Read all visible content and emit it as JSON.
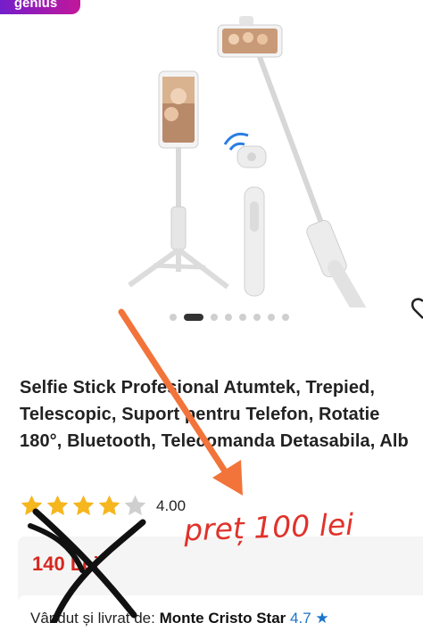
{
  "badge": {
    "label": "genius"
  },
  "gallery": {
    "slide_count": 8,
    "active_index": 1
  },
  "product": {
    "title": "Selfie Stick Profesional Atumtek, Trepied, Telescopic, Suport pentru Telefon, Rotatie 180°, Bluetooth, Telecomanda Detasabila, Alb",
    "rating_value": "4.00",
    "rating_stars": 4,
    "old_price": "140 Lei",
    "seller_prefix": "Vândut și livrat de:",
    "seller_name": "Monte Cristo Star",
    "seller_rating": "4.7"
  },
  "annotation": {
    "handwritten_text": "preț 100 lei"
  },
  "colors": {
    "annotation": "#e0322a",
    "arrow": "#f2743a",
    "star": "#f5b61e",
    "price": "#d6281f"
  }
}
